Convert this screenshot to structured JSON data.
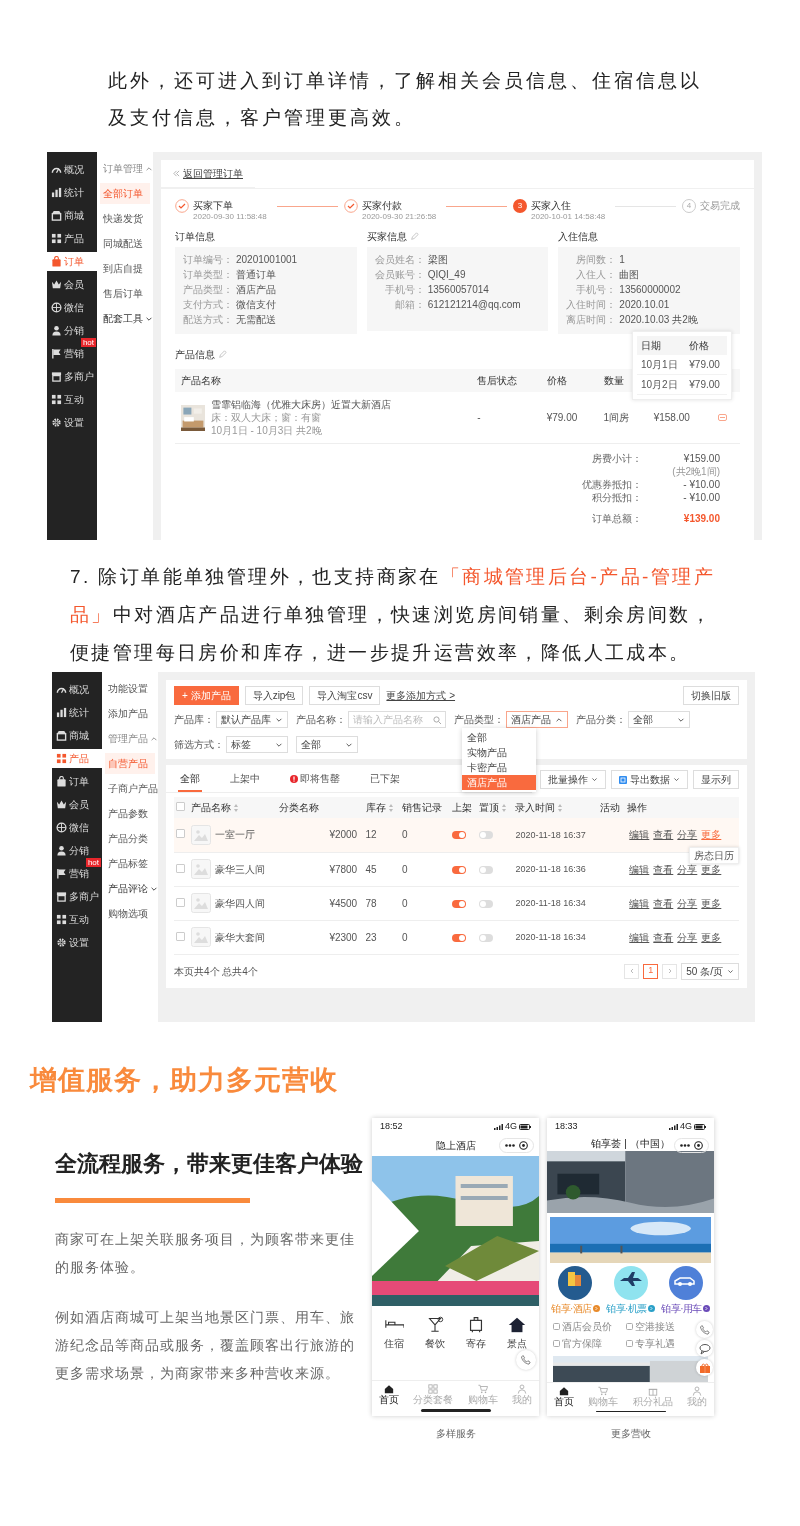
{
  "intro": "此外，还可进入到订单详情，了解相关会员信息、住宿信息以及支付信息，客户管理更高效。",
  "order_screen": {
    "nav": [
      {
        "label": "概况",
        "selected": false
      },
      {
        "label": "统计",
        "selected": false
      },
      {
        "label": "商城",
        "selected": false
      },
      {
        "label": "产品",
        "selected": false
      },
      {
        "label": "订单",
        "selected": true
      },
      {
        "label": "会员",
        "selected": false
      },
      {
        "label": "微信",
        "selected": false
      },
      {
        "label": "分销",
        "selected": false
      },
      {
        "label": "营销",
        "selected": false,
        "badge": "hot"
      },
      {
        "label": "多商户",
        "selected": false
      },
      {
        "label": "互动",
        "selected": false
      },
      {
        "label": "设置",
        "selected": false
      }
    ],
    "subnav": [
      {
        "kind": "group",
        "label": "订单管理",
        "expanded": true
      },
      {
        "kind": "item",
        "label": "全部订单",
        "selected": true
      },
      {
        "kind": "item",
        "label": "快递发货",
        "selected": false
      },
      {
        "kind": "item",
        "label": "同城配送",
        "selected": false
      },
      {
        "kind": "item",
        "label": "到店自提",
        "selected": false
      },
      {
        "kind": "item",
        "label": "售后订单",
        "selected": false
      },
      {
        "kind": "group",
        "label": "配套工具",
        "expanded": false
      }
    ],
    "back_link": "返回管理订单",
    "steps": [
      {
        "completed": true,
        "active": false,
        "title": "买家下单",
        "time": "2020-09-30 11:58:48"
      },
      {
        "completed": true,
        "active": false,
        "title": "买家付款",
        "time": "2020-09-30 21:26:58"
      },
      {
        "completed": false,
        "active": true,
        "number": "3",
        "title": "买家入住",
        "time": "2020-10-01 14:58:48"
      },
      {
        "completed": false,
        "active": false,
        "number": "4",
        "title": "交易完成"
      }
    ],
    "panels": [
      {
        "title": "订单信息",
        "editable": false,
        "fields": [
          {
            "label": "订单编号：",
            "value": "20201001001"
          },
          {
            "label": "订单类型：",
            "value": "普通订单"
          },
          {
            "label": "产品类型：",
            "value": "酒店产品"
          },
          {
            "label": "支付方式：",
            "value": "微信支付"
          },
          {
            "label": "配送方式：",
            "value": "无需配送"
          }
        ]
      },
      {
        "title": "买家信息",
        "editable": true,
        "fields": [
          {
            "label": "会员姓名：",
            "value": "梁图"
          },
          {
            "label": "会员账号：",
            "value": "QIQI_49"
          },
          {
            "label": "手机号：",
            "value": "13560057014"
          },
          {
            "label": "邮箱：",
            "value": "612121214@qq.com"
          }
        ]
      },
      {
        "title": "入住信息",
        "editable": false,
        "fields": [
          {
            "label": "房间数：",
            "value": "1"
          },
          {
            "label": "入住人：",
            "value": "曲图"
          },
          {
            "label": "手机号：",
            "value": "13560000002"
          },
          {
            "label": "入住时间：",
            "value": "2020.10.01"
          },
          {
            "label": "离店时间：",
            "value": "2020.10.03 共2晚"
          }
        ]
      }
    ],
    "products": {
      "title": "产品信息",
      "editable": true,
      "columns": [
        "产品名称",
        "售后状态",
        "价格",
        "数量"
      ],
      "rows": [
        {
          "name": "雪霏铝临海（优雅大床房）近置大新酒店",
          "spec": "床：双人大床；窗：有窗",
          "dates": "10月1日 - 10月3日  共2晚",
          "after_sale": "-",
          "price": "¥79.00",
          "quantity": "1间房",
          "subtotal": "¥158.00"
        }
      ]
    },
    "price_popover": {
      "columns": [
        "日期",
        "价格"
      ],
      "rows": [
        [
          "10月1日",
          "¥79.00"
        ],
        [
          "10月2日",
          "¥79.00"
        ]
      ]
    },
    "summary": [
      {
        "kind": "line",
        "label": "房费小计：",
        "value": "¥159.00",
        "note": "(共2晚1间)"
      },
      {
        "kind": "line",
        "label": "优惠券抵扣：",
        "value": "- ¥10.00"
      },
      {
        "kind": "line",
        "label": "积分抵扣：",
        "value": "- ¥10.00"
      },
      {
        "kind": "total",
        "label": "订单总额：",
        "value": "¥139.00"
      }
    ]
  },
  "section_7": {
    "before": "7. 除订单能单独管理外，也支持商家在",
    "highlight": "「商城管理后台-产品-管理产品」",
    "after": "中对酒店产品进行单独管理，快速浏览房间销量、剩余房间数，便捷管理每日房价和库存，进一步提升运营效率，降低人工成本。"
  },
  "product_screen": {
    "nav": [
      {
        "label": "概况",
        "selected": false
      },
      {
        "label": "统计",
        "selected": false
      },
      {
        "label": "商城",
        "selected": false
      },
      {
        "label": "产品",
        "selected": true
      },
      {
        "label": "订单",
        "selected": false
      },
      {
        "label": "会员",
        "selected": false
      },
      {
        "label": "微信",
        "selected": false
      },
      {
        "label": "分销",
        "selected": false
      },
      {
        "label": "营销",
        "selected": false,
        "badge": "hot"
      },
      {
        "label": "多商户",
        "selected": false
      },
      {
        "label": "互动",
        "selected": false
      },
      {
        "label": "设置",
        "selected": false
      }
    ],
    "subnav": [
      {
        "kind": "item",
        "label": "功能设置",
        "selected": false
      },
      {
        "kind": "item",
        "label": "添加产品",
        "selected": false
      },
      {
        "kind": "group",
        "label": "管理产品",
        "expanded": true
      },
      {
        "kind": "item",
        "label": "自营产品",
        "selected": true
      },
      {
        "kind": "item",
        "label": "子商户产品",
        "selected": false
      },
      {
        "kind": "item",
        "label": "产品参数",
        "selected": false
      },
      {
        "kind": "item",
        "label": "产品分类",
        "selected": false
      },
      {
        "kind": "item",
        "label": "产品标签",
        "selected": false
      },
      {
        "kind": "group",
        "label": "产品评论",
        "expanded": false
      },
      {
        "kind": "item",
        "label": "购物选项",
        "selected": false
      }
    ],
    "toolbar": [
      {
        "kind": "primary",
        "label": "+ 添加产品"
      },
      {
        "kind": "button",
        "label": "导入zip包"
      },
      {
        "kind": "button",
        "label": "导入淘宝csv"
      },
      {
        "kind": "link",
        "label": "更多添加方式 >"
      }
    ],
    "switch_button": "切换旧版",
    "filters": [
      {
        "kind": "select",
        "label": "产品库：",
        "value": "默认产品库",
        "open": false
      },
      {
        "kind": "search",
        "label": "产品名称：",
        "placeholder": "请输入产品名称"
      },
      {
        "kind": "select",
        "label": "产品类型：",
        "value": "酒店产品",
        "open": true,
        "options": [
          {
            "label": "全部",
            "selected": false
          },
          {
            "label": "实物产品",
            "selected": false
          },
          {
            "label": "卡密产品",
            "selected": false
          },
          {
            "label": "酒店产品",
            "selected": true
          }
        ]
      },
      {
        "kind": "select",
        "label": "产品分类：",
        "value": "全部",
        "open": false
      },
      {
        "kind": "select",
        "label": "筛选方式：",
        "value": "标签",
        "open": false
      },
      {
        "kind": "select",
        "value": "全部",
        "open": false
      }
    ],
    "tabs": [
      {
        "label": "全部",
        "selected": true,
        "alert": false
      },
      {
        "label": "上架中",
        "selected": false,
        "alert": false
      },
      {
        "label": "即将售罄",
        "selected": false,
        "alert": true
      },
      {
        "label": "已下架",
        "selected": false,
        "alert": false
      }
    ],
    "actions": [
      {
        "kind": "menu",
        "label": "批量操作"
      },
      {
        "kind": "export",
        "label": "导出数据"
      },
      {
        "kind": "button",
        "label": "显示列"
      }
    ],
    "columns": [
      {
        "label": "产品名称",
        "sortable": true
      },
      {
        "label": "分类名称",
        "sortable": false
      },
      {
        "label": "库存",
        "sortable": true
      },
      {
        "label": "销售记录",
        "sortable": false
      },
      {
        "label": "上架",
        "sortable": false
      },
      {
        "label": "置顶",
        "sortable": true
      },
      {
        "label": "录入时间",
        "sortable": true
      },
      {
        "label": "活动",
        "sortable": false
      },
      {
        "label": "操作",
        "sortable": false
      }
    ],
    "all_checked": false,
    "rows": [
      {
        "name": "一室一厅",
        "price": "¥2000",
        "stock": "12",
        "sales": "0",
        "listed": true,
        "pinned": false,
        "created": "2020-11-18 16:37",
        "checked": false,
        "highlighted": true,
        "actions": [
          "编辑",
          "查看",
          "分享",
          "更多"
        ],
        "tooltip": "房态日历"
      },
      {
        "name": "豪华三人间",
        "price": "¥7800",
        "stock": "45",
        "sales": "0",
        "listed": true,
        "pinned": false,
        "created": "2020-11-18 16:36",
        "checked": false,
        "highlighted": false,
        "actions": [
          "编辑",
          "查看",
          "分享",
          "更多"
        ]
      },
      {
        "name": "豪华四人间",
        "price": "¥4500",
        "stock": "78",
        "sales": "0",
        "listed": true,
        "pinned": false,
        "created": "2020-11-18 16:34",
        "checked": false,
        "highlighted": false,
        "actions": [
          "编辑",
          "查看",
          "分享",
          "更多"
        ]
      },
      {
        "name": "豪华大套间",
        "price": "¥2300",
        "stock": "23",
        "sales": "0",
        "listed": true,
        "pinned": false,
        "created": "2020-11-18 16:34",
        "checked": false,
        "highlighted": false,
        "actions": [
          "编辑",
          "查看",
          "分享",
          "更多"
        ]
      }
    ],
    "footer": "本页共4个 总共4个",
    "pages": [
      {
        "label": "1",
        "selected": true
      }
    ],
    "page_size": "50 条/页"
  },
  "services": {
    "heading": "增值服务，助力多元营收",
    "subheading": "全流程服务，带来更佳客户体验",
    "paragraphs": [
      "商家可在上架关联服务项目，为顾客带来更佳的服务体验。",
      "例如酒店商城可上架当地景区门票、用车、旅游纪念品等商品或服务，覆盖顾客出行旅游的更多需求场景，为商家带来多种营收来源。"
    ],
    "phones": [
      {
        "kind": "hotel",
        "time": "18:52",
        "network": "4G",
        "title": "隐上酒店",
        "shortcuts": [
          "住宿",
          "餐饮",
          "寄存",
          "景点"
        ],
        "tabs": [
          {
            "label": "首页",
            "selected": true
          },
          {
            "label": "分类套餐",
            "selected": false
          },
          {
            "label": "购物车",
            "selected": false
          },
          {
            "label": "我的",
            "selected": false
          }
        ],
        "caption": "多样服务"
      },
      {
        "kind": "mall",
        "time": "18:33",
        "network": "4G",
        "title": "铂享荟 | （中国）",
        "services": [
          "铂享·酒店",
          "铂享·机票",
          "铂享·用车"
        ],
        "features": [
          "酒店会员价",
          "空港接送",
          "官方保障",
          "专享礼遇"
        ],
        "tabs": [
          {
            "label": "首页",
            "selected": true
          },
          {
            "label": "购物车",
            "selected": false
          },
          {
            "label": "积分礼品",
            "selected": false
          },
          {
            "label": "我的",
            "selected": false
          }
        ],
        "caption": "更多营收"
      }
    ]
  }
}
